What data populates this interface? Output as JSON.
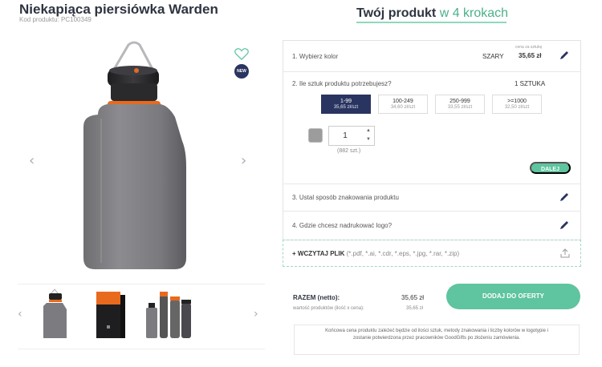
{
  "product": {
    "title": "Niekapiąca piersiówka Warden",
    "code": "Kod produktu: PC100349"
  },
  "steps_header": {
    "bold": "Twój produkt",
    "light": " w 4 krokach"
  },
  "gallery": {
    "new_badge": "NEW",
    "prev_arrow": "‹",
    "next_arrow": "›"
  },
  "step1": {
    "label": "1. Wybierz kolor",
    "color_value": "SZARY",
    "price_caption": "cena za sztukę",
    "price": "35,65 zł"
  },
  "step2": {
    "label": "2. Ile sztuk produktu potrzebujesz?",
    "quantity_value": "1 SZTUKA",
    "tiers": [
      {
        "qty": "1-99",
        "price": "35,65 zł/szt"
      },
      {
        "qty": "100-249",
        "price": "34,60 zł/szt"
      },
      {
        "qty": "250-999",
        "price": "33,55 zł/szt"
      },
      {
        "qty": ">=1000",
        "price": "32,50 zł/szt"
      }
    ],
    "qty_input": "1",
    "stock": "(882 szt.)",
    "next_button": "DALEJ"
  },
  "step3": {
    "label": "3. Ustal sposób znakowania produktu"
  },
  "step4": {
    "label": "4. Gdzie chcesz nadrukować logo?"
  },
  "upload": {
    "label": "+ WCZYTAJ PLIK",
    "extensions": " (*.pdf, *.ai, *.cdr, *.eps, *.jpg, *.rar, *.zip)"
  },
  "summary": {
    "total_label": "RAZEM (netto):",
    "total_value": "35,65 zł",
    "sub_label": "wartość produktów (ilość x cena):",
    "sub_value": "35,65 zł",
    "add_button": "DODAJ DO OFERTY",
    "note": "Końcowa cena produktu zależeć będzie od ilości sztuk, metody znakowania i liczby kolorów w logotypie i zostanie potwierdzona przez pracowników GoodGifts po złożeniu zamówienia."
  },
  "colors": {
    "accent": "#5fc4a0",
    "navy": "#2a3460",
    "swatch": "#9c9c9c"
  }
}
